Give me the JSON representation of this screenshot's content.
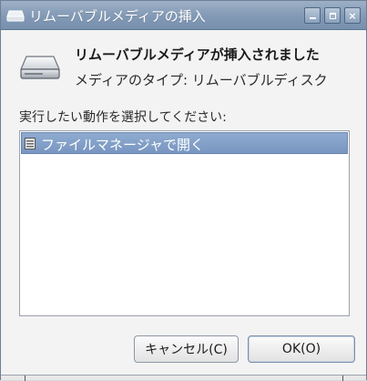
{
  "window": {
    "title": "リムーバブルメディアの挿入",
    "minimize_icon": "minimize-icon",
    "maximize_icon": "maximize-icon",
    "close_label": "×"
  },
  "dialog": {
    "icon": "removable-drive-icon",
    "heading": "リムーバブルメディアが挿入されました",
    "media_type": "メディアのタイプ:  リムーバブルディスク",
    "prompt": "実行したい動作を選択してください:"
  },
  "actions": {
    "items": [
      {
        "label": "ファイルマネージャで開く",
        "icon": "file-manager-icon",
        "selected": true
      }
    ]
  },
  "buttons": {
    "cancel": "キャンセル(C)",
    "ok": "OK(O)"
  },
  "colors": {
    "titlebar": "#8299b5",
    "selection": "#7f9dc7",
    "background": "#f3f3f3"
  }
}
